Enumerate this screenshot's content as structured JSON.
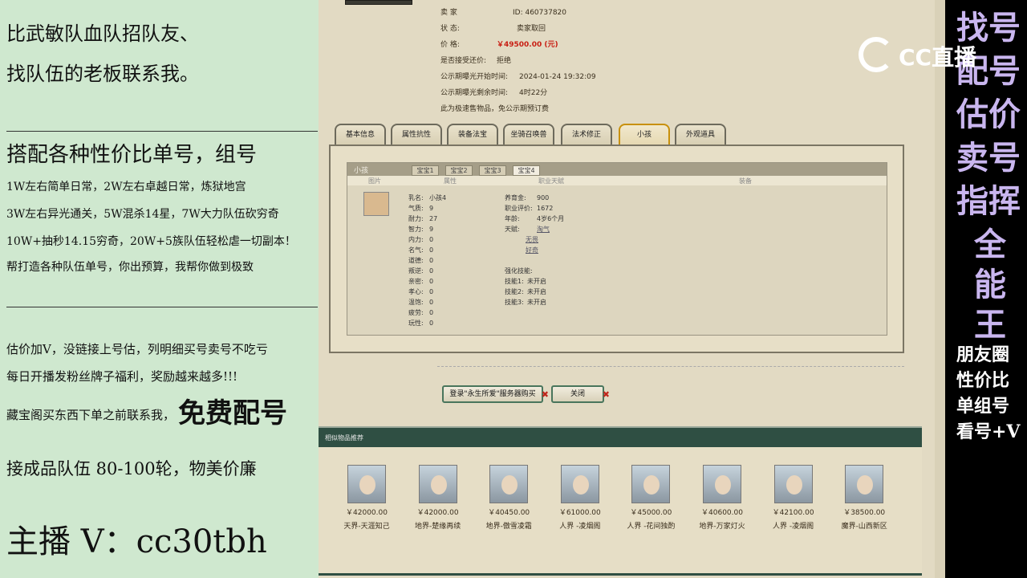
{
  "left_panel": {
    "lines_top": [
      "比武敏队血队招队友、",
      "找队伍的老板联系我。"
    ],
    "heading": "搭配各种性价比单号，组号",
    "lines_small": [
      "1W左右简单日常，2W左右卓越日常，炼狱地宫",
      "3W左右异光通关，5W混杀14星，7W大力队伍砍穷奇",
      "10W+抽秒14.15穷奇，20W+5族队伍轻松虐一切副本！",
      "帮打造各种队伍单号，你出预算，我帮你做到极致"
    ],
    "lines_mid": [
      "估价加V，没链接上号估，列明细买号卖号不吃亏",
      "每日开播发粉丝牌子福利，奖励越来越多!!!"
    ],
    "line_free_prefix": "藏宝阁买东西下单之前联系我，",
    "line_free_big": "免费配号",
    "line_team": "接成品队伍 80-100轮，物美价廉",
    "streamer": "主播 V：cc30tbh"
  },
  "listing": {
    "seller_label": "卖    家",
    "seller_value": "ID:    460737820",
    "status_label": "状        态:",
    "status_value": "卖家取回",
    "price_label": "价        格:",
    "price_value": "￥49500.00 (元)",
    "counter_label": "是否接受还价:",
    "counter_value": "拒绝",
    "pub_start_label": "公示期曝光开始时间:",
    "pub_start_value": "2024-01-24 19:32:09",
    "pub_remain_label": "公示期曝光剩余时间:",
    "pub_remain_value": "4时22分",
    "note": "此为极速售物品，免公示期预订费"
  },
  "tabs": [
    "基本信息",
    "属性抗性",
    "装备法宝",
    "坐骑召唤兽",
    "法术修正",
    "小孩",
    "外观道具"
  ],
  "active_tab": "小孩",
  "child_panel": {
    "title": "小孩",
    "subtabs": [
      "宝宝1",
      "宝宝2",
      "宝宝3",
      "宝宝4"
    ],
    "active_subtab": "宝宝4",
    "col_headers": [
      "图片",
      "属性",
      "职业天赋",
      "装备"
    ],
    "attrs_left": [
      {
        "k": "乳名:",
        "v": "小孩4"
      },
      {
        "k": "气质:",
        "v": "9"
      },
      {
        "k": "耐力:",
        "v": "27"
      },
      {
        "k": "智力:",
        "v": "9"
      },
      {
        "k": "内力:",
        "v": "0"
      },
      {
        "k": "名气:",
        "v": "0"
      },
      {
        "k": "道德:",
        "v": "0"
      },
      {
        "k": "叛逆:",
        "v": "0"
      },
      {
        "k": "亲密:",
        "v": "0"
      },
      {
        "k": "孝心:",
        "v": "0"
      },
      {
        "k": "温饱:",
        "v": "0"
      },
      {
        "k": "疲劳:",
        "v": "0"
      },
      {
        "k": "玩性:",
        "v": "0"
      }
    ],
    "attrs_right": [
      {
        "k": "养育金:",
        "v": "900"
      },
      {
        "k": "职业评价:",
        "v": "1672"
      },
      {
        "k": "年龄:",
        "v": "4岁6个月"
      },
      {
        "k": "天赋:",
        "v": "淘气"
      }
    ],
    "talents_extra": [
      "无畏",
      "好奇"
    ],
    "enhance_label": "强化技能:",
    "skills": [
      {
        "k": "技能1:",
        "v": "未开启"
      },
      {
        "k": "技能2:",
        "v": "未开启"
      },
      {
        "k": "技能3:",
        "v": "未开启"
      }
    ]
  },
  "buttons": {
    "buy": "登录\"永生所爱\"服务器购买",
    "close": "关闭"
  },
  "recommend": {
    "title": "相似物品推荐",
    "items": [
      {
        "price": "￥42000.00",
        "name": "天界-天涯知己"
      },
      {
        "price": "￥42000.00",
        "name": "地界-楚缘再续"
      },
      {
        "price": "￥40450.00",
        "name": "地界-傲雪凌霜"
      },
      {
        "price": "￥61000.00",
        "name": "人界 -凌烟阁"
      },
      {
        "price": "￥45000.00",
        "name": "人界 -花间独酌"
      },
      {
        "price": "￥40600.00",
        "name": "地界-万家灯火"
      },
      {
        "price": "￥42100.00",
        "name": "人界 -凌烟阁"
      },
      {
        "price": "￥38500.00",
        "name": "魔界-山西新区"
      }
    ]
  },
  "logo": "CC直播",
  "right_strip": {
    "vertical": [
      "找号",
      "配号",
      "估价",
      "卖号",
      "指挥",
      "全",
      "能",
      "王"
    ],
    "white_lines": [
      "朋友圈",
      "性价比",
      "单组号",
      "看号+V"
    ]
  },
  "colors": {
    "left_bg": "#cfe8cf",
    "price_red": "#c81e13",
    "accent_purple": "#c9b6ef",
    "rec_bar": "#2f4f43"
  }
}
